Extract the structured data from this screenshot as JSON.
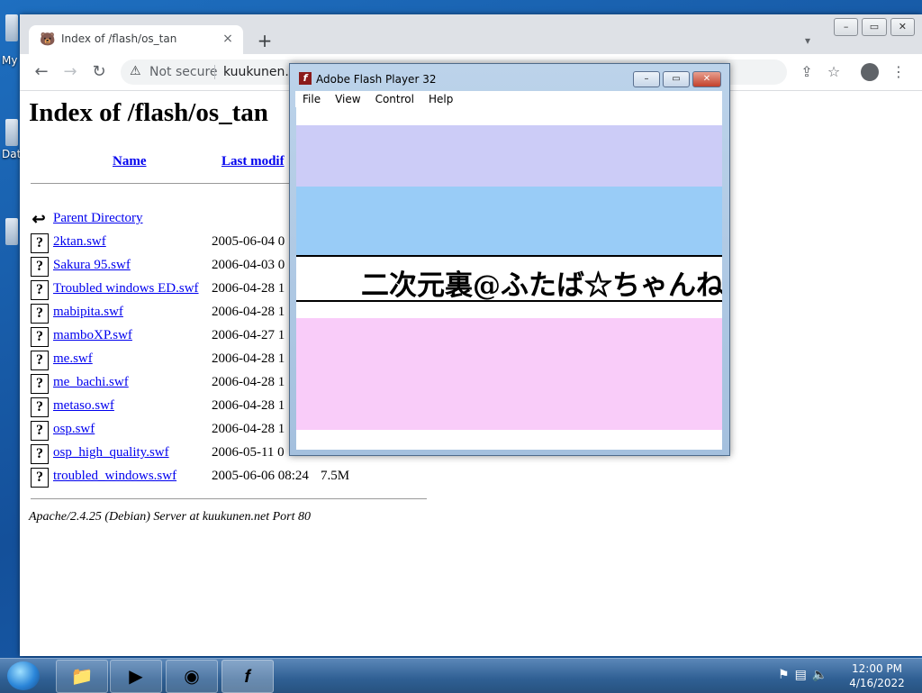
{
  "desktop": {
    "label_my": "My",
    "label_dat": "Dat"
  },
  "browser": {
    "tab_title": "Index of /flash/os_tan",
    "new_tab": "+",
    "tab_close": "×",
    "address": {
      "security": "Not secure",
      "url": "kuukunen.n"
    }
  },
  "page": {
    "title": "Index of /flash/os_tan",
    "headers": {
      "name": "Name",
      "last_modified": "Last modif"
    },
    "parent": "Parent Directory",
    "files": [
      {
        "name": "2ktan.swf",
        "date": "2005-06-04 0",
        "size": ""
      },
      {
        "name": "Sakura 95.swf",
        "date": "2006-04-03 0",
        "size": ""
      },
      {
        "name": "Troubled windows ED.swf",
        "date": "2006-04-28 1",
        "size": ""
      },
      {
        "name": "mabipita.swf",
        "date": "2006-04-28 1",
        "size": ""
      },
      {
        "name": "mamboXP.swf",
        "date": "2006-04-27 1",
        "size": ""
      },
      {
        "name": "me.swf",
        "date": "2006-04-28 1",
        "size": ""
      },
      {
        "name": "me_bachi.swf",
        "date": "2006-04-28 1",
        "size": ""
      },
      {
        "name": "metaso.swf",
        "date": "2006-04-28 1",
        "size": ""
      },
      {
        "name": "osp.swf",
        "date": "2006-04-28 1",
        "size": ""
      },
      {
        "name": "osp_high_quality.swf",
        "date": "2006-05-11 0",
        "size": ""
      },
      {
        "name": "troubled_windows.swf",
        "date": "2005-06-06 08:24",
        "size": "7.5M"
      }
    ],
    "footer": "Apache/2.4.25 (Debian) Server at kuukunen.net Port 80"
  },
  "flash": {
    "title": "Adobe Flash Player 32",
    "menu": [
      "File",
      "View",
      "Control",
      "Help"
    ],
    "banner": "二次元裏@ふたば☆ちゃんね",
    "bands": [
      "#ccccf7",
      "#99ccf7",
      "#ffffff",
      "#f9ccf9"
    ]
  },
  "taskbar": {
    "time": "12:00 PM",
    "date": "4/16/2022"
  }
}
